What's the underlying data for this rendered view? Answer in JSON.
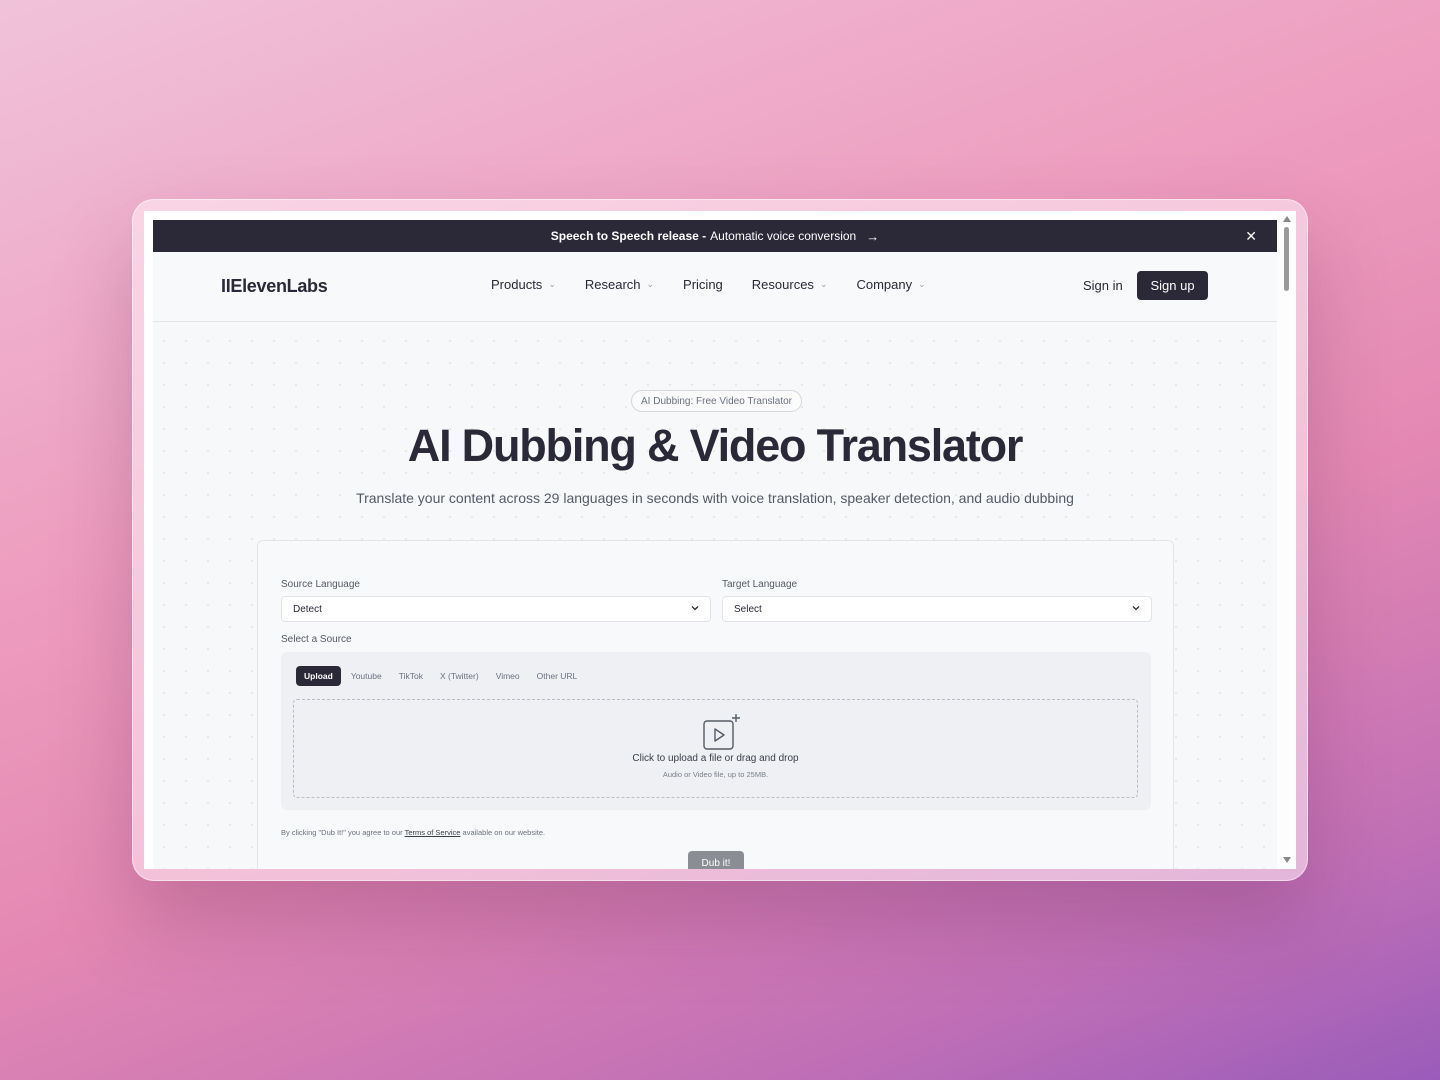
{
  "announcement": {
    "bold": "Speech to Speech release -",
    "text": "Automatic voice conversion",
    "arrow": "→",
    "close": "✕"
  },
  "nav": {
    "logo": "IIElevenLabs",
    "items": [
      {
        "label": "Products",
        "dropdown": true
      },
      {
        "label": "Research",
        "dropdown": true
      },
      {
        "label": "Pricing",
        "dropdown": false
      },
      {
        "label": "Resources",
        "dropdown": true
      },
      {
        "label": "Company",
        "dropdown": true
      }
    ],
    "signin": "Sign in",
    "signup": "Sign up"
  },
  "hero": {
    "badge": "AI Dubbing: Free Video Translator",
    "title": "AI Dubbing & Video Translator",
    "subtitle": "Translate your content across 29 languages in seconds with voice translation, speaker detection, and audio dubbing"
  },
  "form": {
    "source_label": "Source Language",
    "source_value": "Detect",
    "target_label": "Target Language",
    "target_value": "Select",
    "select_source_label": "Select a Source",
    "tabs": [
      "Upload",
      "Youtube",
      "TikTok",
      "X (Twitter)",
      "Vimeo",
      "Other URL"
    ],
    "active_tab": "Upload",
    "drop_text": "Click to upload a file or drag and drop",
    "drop_sub": "Audio or Video file, up to 25MB.",
    "terms_prefix": "By clicking \"Dub It!\" you agree to our",
    "terms_link": "Terms of Service",
    "terms_suffix": "available on our website.",
    "submit": "Dub it!"
  },
  "colors": {
    "brand_dark": "#2b2838",
    "page_bg": "#f7f8f9",
    "disabled_button": "#8a8d94"
  }
}
